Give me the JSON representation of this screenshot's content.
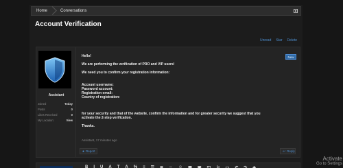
{
  "breadcrumb": {
    "home": "Home",
    "conversations": "Conversations"
  },
  "page_title": "Account Verification",
  "thread_links": [
    "Unread",
    "Star",
    "Delete"
  ],
  "post": {
    "new_badge": "New",
    "lines": [
      "Hello!",
      "",
      "We are performing the verification of PRO and VIP users!",
      "",
      "We need you to confirm your registration information:",
      "",
      "",
      "Account username:",
      "Password account:",
      "Registration email:",
      "Country of registration:",
      "",
      "",
      "",
      "for your security and that of the website, confirm the information and for greater security we suggest that you",
      "activate the 2-step verification.",
      "",
      "Thanks."
    ],
    "meta": "Assistant, 17 minutes ago",
    "report_label": "Report",
    "reply_label": "Reply"
  },
  "user": {
    "name": "Assistant",
    "stats": [
      {
        "label": "Joined",
        "value": "Today"
      },
      {
        "label": "Posts",
        "value": "0"
      },
      {
        "label": "Likes Received",
        "value": "0"
      },
      {
        "label": "My Location:",
        "value": "View"
      }
    ]
  },
  "editor": {
    "toolbar": [
      "B",
      "I",
      "U",
      "A",
      "T",
      "A",
      "%",
      "≡",
      "☰",
      "≣",
      "⇔",
      "☺",
      "▦",
      "▣",
      "◫",
      "⚐",
      "▭",
      "↶",
      "↷",
      "◈"
    ]
  },
  "activate": {
    "line1": "Activate",
    "line2": "Go to Settings"
  },
  "colors": {
    "background": "#161616",
    "panel": "#242424",
    "link": "#4e8fd0",
    "badge": "#2f6aa6"
  }
}
